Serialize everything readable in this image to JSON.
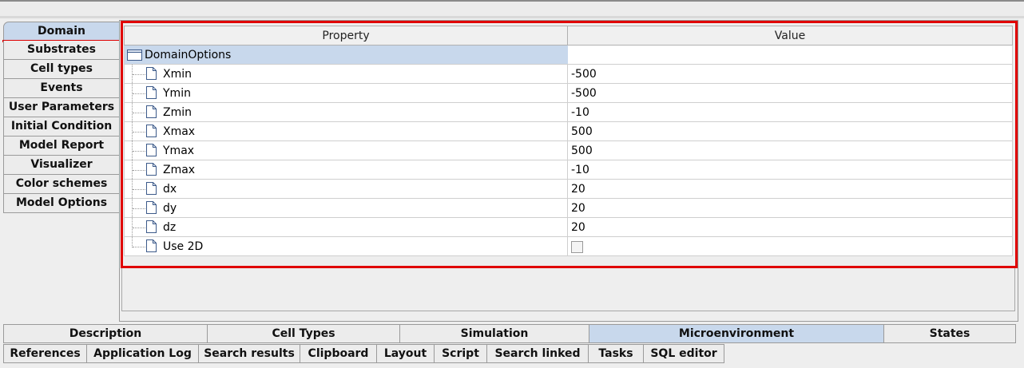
{
  "left_tabs": [
    "Domain",
    "Substrates",
    "Cell types",
    "Events",
    "User Parameters",
    "Initial Condition",
    "Model Report",
    "Visualizer",
    "Color schemes",
    "Model Options"
  ],
  "grid": {
    "headers": {
      "property": "Property",
      "value": "Value"
    },
    "group_label": "DomainOptions",
    "rows": [
      {
        "label": "Xmin",
        "value": "-500"
      },
      {
        "label": "Ymin",
        "value": "-500"
      },
      {
        "label": "Zmin",
        "value": "-10"
      },
      {
        "label": "Xmax",
        "value": "500"
      },
      {
        "label": "Ymax",
        "value": "500"
      },
      {
        "label": "Zmax",
        "value": "-10"
      },
      {
        "label": "dx",
        "value": "20"
      },
      {
        "label": "dy",
        "value": "20"
      },
      {
        "label": "dz",
        "value": "20"
      },
      {
        "label": "Use 2D",
        "value": ""
      }
    ]
  },
  "bottom_tabs_row1": [
    "Description",
    "Cell Types",
    "Simulation",
    "Microenvironment",
    "States"
  ],
  "bottom_tabs_row2": [
    "References",
    "Application Log",
    "Search results",
    "Clipboard",
    "Layout",
    "Script",
    "Search linked",
    "Tasks",
    "SQL editor"
  ],
  "icons": {
    "group": "folder-icon",
    "item": "document-icon",
    "checkbox": "checkbox-icon"
  },
  "colors": {
    "highlight": "#e00000",
    "active_tab": "#c8d8ec",
    "group_row": "#c8d8ec"
  }
}
